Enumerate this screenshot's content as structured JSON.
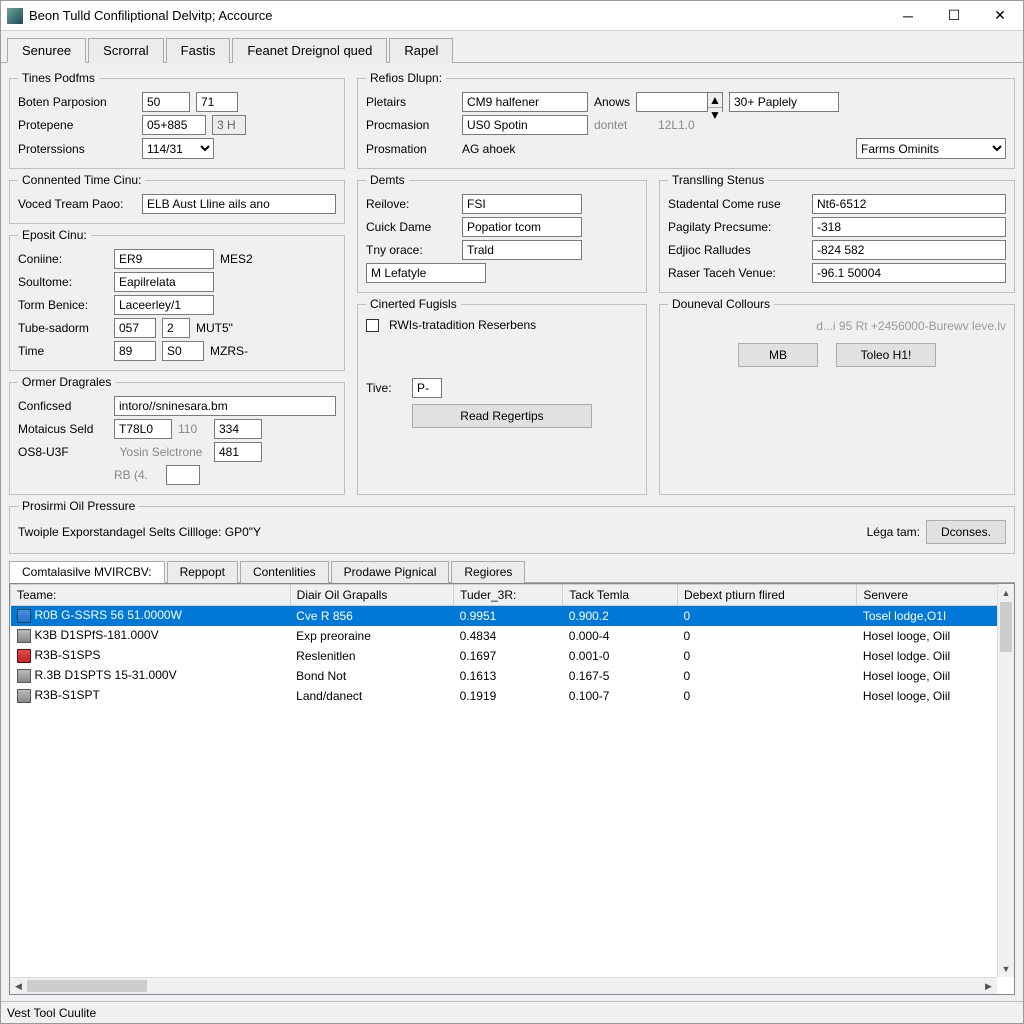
{
  "title": "Beon Tulld Confiliptional Delvitp; Accource",
  "tabs": [
    "Senuree",
    "Scrorral",
    "Fastis",
    "Feanet Dreignol qued",
    "Rapel"
  ],
  "active_tab": 0,
  "tines_podfms": {
    "legend": "Tines Podfms",
    "boten_parposion_label": "Boten Parposion",
    "boten_parposion_a": "50",
    "boten_parposion_b": "71",
    "protepene_label": "Protepene",
    "protepene_a": "05+885",
    "protepene_b": "3 H",
    "proterssions_label": "Proterssions",
    "proterssions": "114/31"
  },
  "refios": {
    "legend": "Refios Dlupn:",
    "pletairs_label": "Pletairs",
    "pletairs": "CM9 halfener",
    "procmasion_label": "Procmasion",
    "procmasion": "US0 Spotin",
    "procmasion_hint": "dontet",
    "procmasion_hint2": "12L1.0",
    "prosmation_label": "Prosmation",
    "prosmation": "AG ahoek",
    "anows_label": "Anows",
    "anows": "",
    "paplely": "30+ Paplely",
    "farms_omints": "Farms Ominits"
  },
  "connented": {
    "legend": "Connented Time Cinu:",
    "voced_label": "Voced Tream Paoo:",
    "voced": "ELB Aust Lline ails ano"
  },
  "eposit": {
    "legend": "Eposit Cinu:",
    "coniine_label": "Coniine:",
    "coniine": "ER9",
    "coniine_unit": "MES2",
    "soultome_label": "Soultome:",
    "soultome": "Eapilrelata",
    "torm_benice_label": "Torm Benice:",
    "torm_benice": "Laceerley/1",
    "tube_sadorm_label": "Tube-sadorm",
    "tube_sadorm_a": "057",
    "tube_sadorm_b": "2",
    "tube_sadorm_unit": "MUT5\"",
    "time_label": "Time",
    "time_a": "89",
    "time_b": "S0",
    "time_unit": "MZRS-"
  },
  "ormer": {
    "legend": "Ormer Dragrales",
    "conficsed_label": "Conficsed",
    "conficsed": "intoro//sninesara.bm",
    "motaicus_label": "Motaicus Seld",
    "motaicus_a": "T78L0",
    "motaicus_b": "110",
    "motaicus_c": "334",
    "os8_label": "OS8-U3F",
    "yosn_txt": "Yosin Selctrone",
    "yosn_val": "481",
    "rb_label": "RB (4.",
    "rb_val": ""
  },
  "demts": {
    "legend": "Demts",
    "reifove_label": "Reilove:",
    "reifove": "FSI",
    "cuick_label": "Cuick Dame",
    "cuick": "Popatior tcom",
    "tny_label": "Tny orace:",
    "tny": "Trald",
    "mlefa": "M Lefatyle"
  },
  "cinerted": {
    "legend": "Cinerted Fugisls",
    "check_label": "RWIs-tratadition Reserbens",
    "time_label": "Tive:",
    "time": "P-",
    "read_btn": "Read Regertips"
  },
  "translling": {
    "legend": "Translling Stenus",
    "stadental_label": "Stadental Come ruse",
    "stadental": "Nt6-6512",
    "pagilaty_label": "Pagilaty Precsume:",
    "pagilaty": "-318",
    "edjioc_label": "Edjioc Ralludes",
    "edjioc": "-824 582",
    "raser_label": "Raser Taceh Venue:",
    "raser": "-96.1 50004"
  },
  "douneval": {
    "legend": "Douneval Collours",
    "hint": "d...i  95  Rt  +2456000-Burewv leve.lv",
    "mb_btn": "MB",
    "toleo_btn": "Toleo H1!"
  },
  "prosm_oil": {
    "legend": "Prosirmi Oil Pressure",
    "twoiple": "Twoiple Exporstandagel Selts Cillloge: GP0\"Y",
    "lega_tam": "Léga tam:",
    "dconses_btn": "Dconses."
  },
  "table_tabs": [
    "Comtalasilve MVIRCBV:",
    "Reppopt",
    "Contenlities",
    "Prodawe Pignical",
    "Regiores"
  ],
  "active_table_tab": 0,
  "table": {
    "columns": [
      "Teame:",
      "Diair Oil Grapalls",
      "Tuder_3R:",
      "Tack Temla",
      "Debext ptiurn flired",
      "Senvere"
    ],
    "rows": [
      {
        "icon": "blue",
        "c": [
          "R0B G-SSRS 56 51.0000W",
          "Cve R 856",
          "0.9951",
          "0.900.2",
          "0",
          "Tosel lodge,O1I"
        ],
        "sel": true
      },
      {
        "icon": "grey",
        "c": [
          "K3B D1SPfS-181.000V",
          "Exp preoraine",
          "0.4834",
          "0.000-4",
          "0",
          "Hosel looge, Oiil"
        ],
        "sel": false
      },
      {
        "icon": "red",
        "c": [
          "R3B-S1SPS",
          "Reslenitlen",
          "0.1697",
          "0.001-0",
          "0",
          "Hosel lodge. Oiil"
        ],
        "sel": false
      },
      {
        "icon": "grey",
        "c": [
          "R.3B D1SPTS 15-31.000V",
          "Bond Not",
          "0.1613",
          "0.167-5",
          "0",
          "Hosel looge, Oiil"
        ],
        "sel": false
      },
      {
        "icon": "grey",
        "c": [
          "R3B-S1SPT",
          "Land/danect",
          "0.1919",
          "0.100-7",
          "0",
          "Hosel looge, Oiil"
        ],
        "sel": false
      }
    ]
  },
  "status": "Vest Tool Cuulite"
}
